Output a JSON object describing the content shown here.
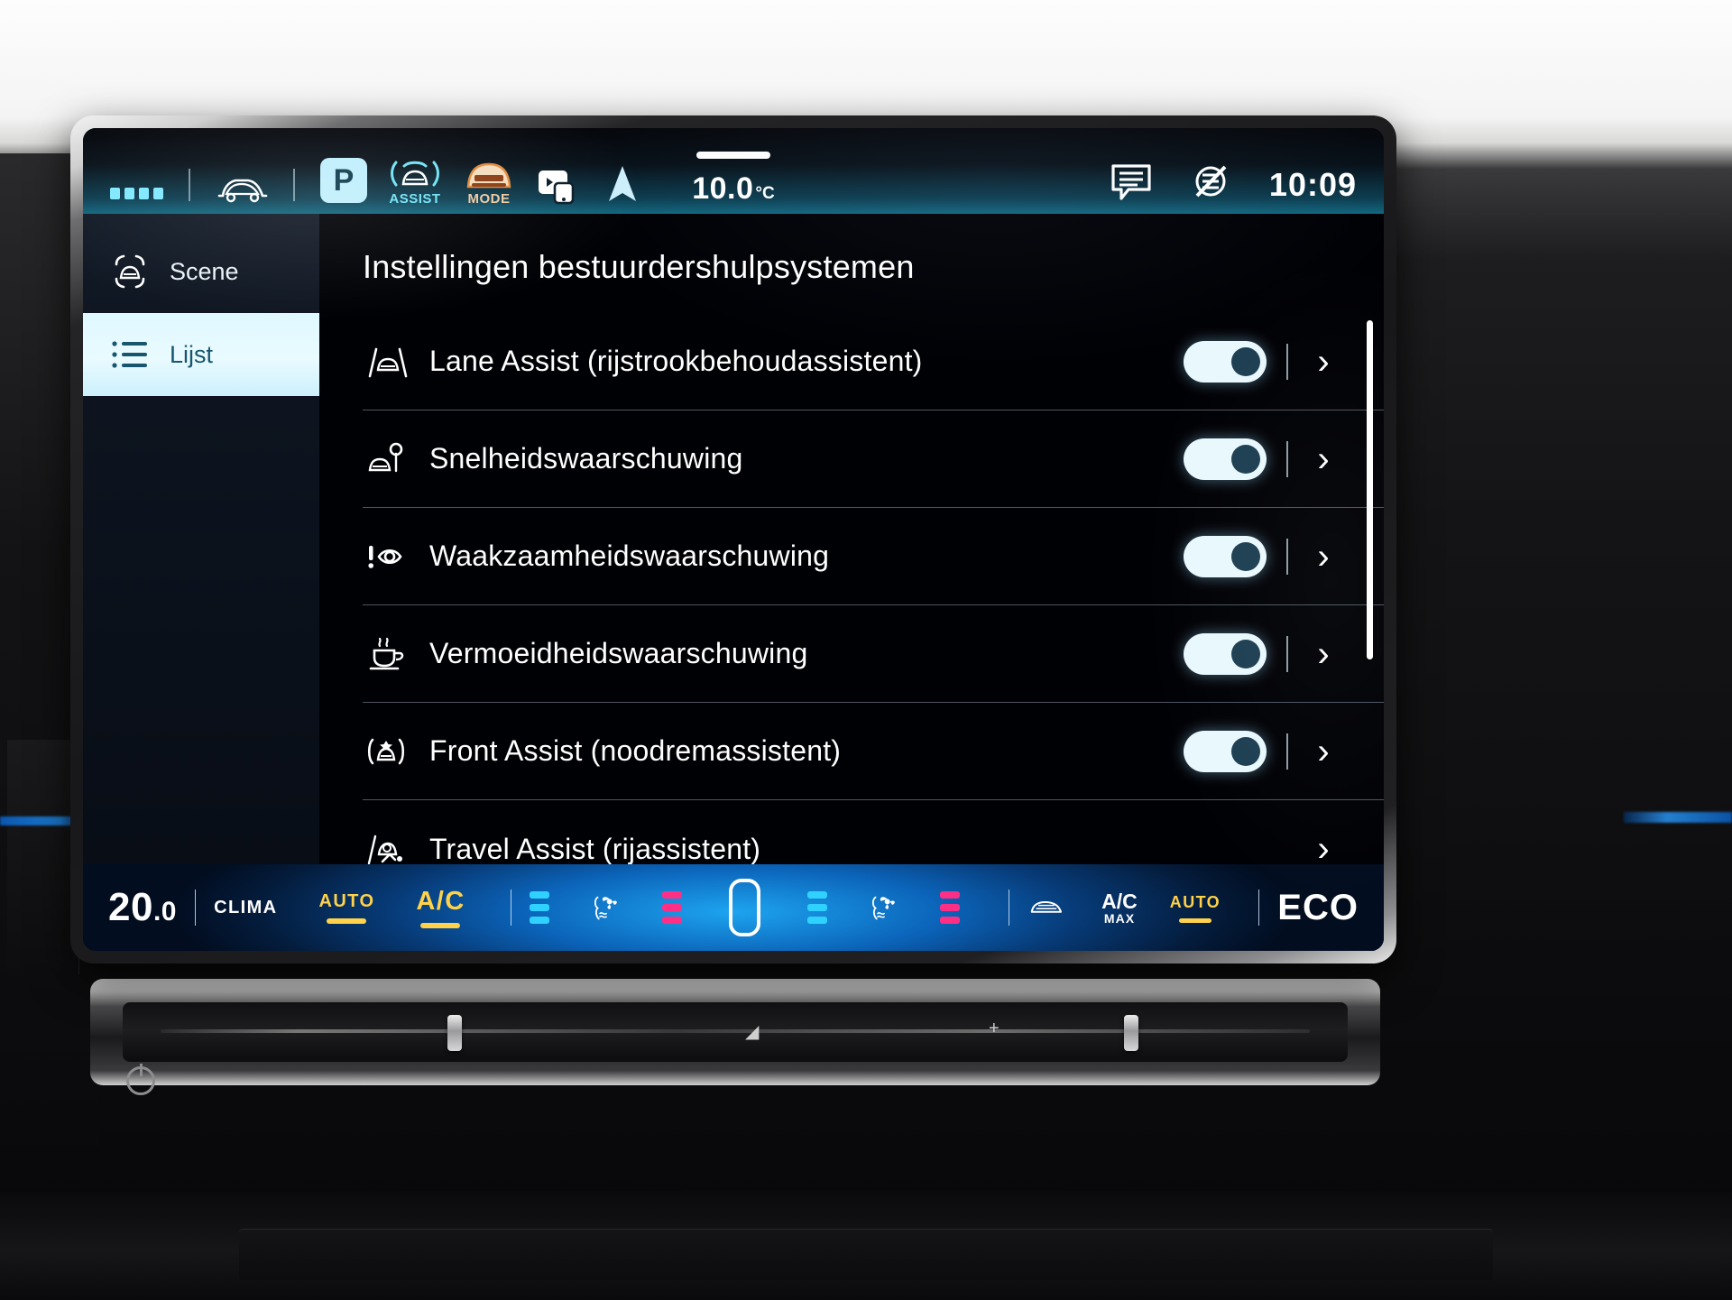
{
  "statusbar": {
    "apps_icon": "grid-apps-icon",
    "car_icon": "car-side-icon",
    "park_badge": "P",
    "assist_label": "ASSIST",
    "mode_label": "MODE",
    "phone_icon": "phone-connect-icon",
    "nav_icon": "navigation-arrow-icon",
    "temperature": "10.0",
    "temperature_unit": "°C",
    "message_icon": "message-bubble-icon",
    "mute_icon": "sound-muted-icon",
    "clock": "10:09"
  },
  "sidebar": {
    "items": [
      {
        "label": "Scene",
        "icon": "car-sensor-icon",
        "active": false
      },
      {
        "label": "Lijst",
        "icon": "list-icon",
        "active": true
      }
    ]
  },
  "main": {
    "title": "Instellingen bestuurdershulpsystemen",
    "rows": [
      {
        "label": "Lane Assist (rijstrookbehoudassistent)",
        "icon": "lane-assist-icon",
        "toggle": true,
        "toggle_on": true,
        "chevron": "›"
      },
      {
        "label": "Snelheidswaarschuwing",
        "icon": "speed-warning-icon",
        "toggle": true,
        "toggle_on": true,
        "chevron": "›"
      },
      {
        "label": "Waakzaamheidswaarschuwing",
        "icon": "attention-eye-icon",
        "toggle": true,
        "toggle_on": true,
        "chevron": "›"
      },
      {
        "label": "Vermoeidheidswaarschuwing",
        "icon": "coffee-cup-icon",
        "toggle": true,
        "toggle_on": true,
        "chevron": "›"
      },
      {
        "label": "Front Assist (noodremassistent)",
        "icon": "front-assist-icon",
        "toggle": true,
        "toggle_on": true,
        "chevron": "›"
      },
      {
        "label": "Travel Assist (rijassistent)",
        "icon": "travel-assist-icon",
        "toggle": false,
        "toggle_on": false,
        "chevron": "›"
      }
    ]
  },
  "climate": {
    "temp_int": "20",
    "temp_dec": ".0",
    "clima_label": "CLIMA",
    "auto_label": "AUTO",
    "ac_label": "A/C",
    "left_seat_icon": "seat-fan-heat-icon",
    "center_icon": "display-square-icon",
    "right_seat_icon": "seat-fan-heat-icon",
    "defrost_icon": "rear-defrost-icon",
    "acmax_line1": "A/C",
    "acmax_line2": "MAX",
    "auto_right_label": "AUTO",
    "eco_label": "ECO"
  },
  "colors": {
    "accent_cyan": "#2fd2ff",
    "accent_amber": "#ffd24a",
    "accent_pink": "#ff2f86",
    "active_panel": "#e9fbff"
  }
}
